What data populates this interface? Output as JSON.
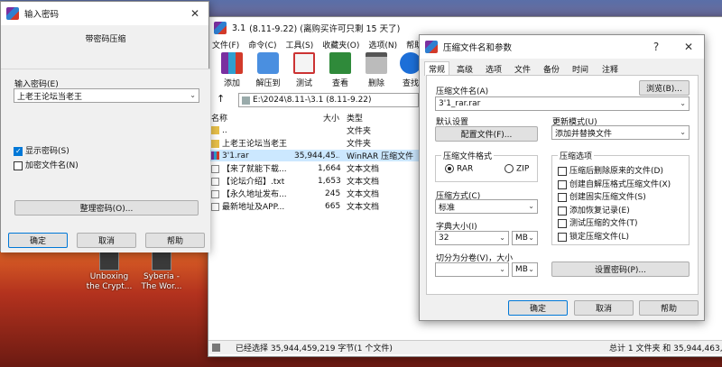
{
  "password_dialog": {
    "title": "输入密码",
    "heading": "带密码压缩",
    "password_label": "输入密码(E)",
    "password_value": "上老王论坛当老王",
    "show_password": "显示密码(S)",
    "encrypt_names": "加密文件名(N)",
    "organize_button": "整理密码(O)...",
    "ok": "确定",
    "cancel": "取消",
    "help": "帮助"
  },
  "winrar": {
    "title": "3.1",
    "subtitle": "(8.11-9.22) (离购买许可只剩 15 天了)",
    "menu": [
      "文件(F)",
      "命令(C)",
      "工具(S)",
      "收藏夹(O)",
      "选项(N)",
      "帮助"
    ],
    "toolbar": [
      "添加",
      "解压到",
      "测试",
      "查看",
      "删除",
      "查找"
    ],
    "up_label": "↑",
    "path": "E:\\2024\\8.11-\\3.1  (8.11-9.22)",
    "columns": {
      "name": "名称",
      "size": "大小",
      "type": "类型"
    },
    "files": [
      {
        "name": "..",
        "size": "",
        "type": "文件夹",
        "kind": "folder"
      },
      {
        "name": "上老王论坛当老王",
        "size": "",
        "type": "文件夹",
        "kind": "folder"
      },
      {
        "name": "3'1.rar",
        "size": "35,944,45...",
        "type": "WinRAR 压缩文件",
        "kind": "rar"
      },
      {
        "name": "【来了就能下载...",
        "size": "1,664",
        "type": "文本文档",
        "kind": "txt"
      },
      {
        "name": "【论坛介绍】.txt",
        "size": "1,653",
        "type": "文本文档",
        "kind": "txt"
      },
      {
        "name": "【永久地址发布...",
        "size": "245",
        "type": "文本文档",
        "kind": "txt"
      },
      {
        "name": "最新地址及APP...",
        "size": "665",
        "type": "文本文档",
        "kind": "txt"
      }
    ],
    "status_left": "已经选择 35,944,459,219 字节(1 个文件)",
    "status_right": "总计 1 文件夹 和 35,944,463,4"
  },
  "archive_dialog": {
    "title": "压缩文件名和参数",
    "help_glyph": "?",
    "tabs": [
      "常规",
      "高级",
      "选项",
      "文件",
      "备份",
      "时间",
      "注释"
    ],
    "archive_name_label": "压缩文件名(A)",
    "browse_button": "浏览(B)...",
    "archive_name_value": "3'1_rar.rar",
    "default_settings_label": "默认设置",
    "profiles_button": "配置文件(F)...",
    "update_mode_label": "更新模式(U)",
    "update_mode_value": "添加并替换文件",
    "format_group": "压缩文件格式",
    "format_rar": "RAR",
    "format_zip": "ZIP",
    "options_group": "压缩选项",
    "options": [
      "压缩后删除原来的文件(D)",
      "创建自解压格式压缩文件(X)",
      "创建固实压缩文件(S)",
      "添加恢复记录(E)",
      "测试压缩的文件(T)",
      "锁定压缩文件(L)"
    ],
    "method_label": "压缩方式(C)",
    "method_value": "标准",
    "dict_label": "字典大小(I)",
    "dict_value": "32",
    "dict_unit": "MB",
    "split_label": "切分为分卷(V)，大小",
    "split_value": "",
    "split_unit": "MB",
    "set_password_button": "设置密码(P)...",
    "ok": "确定",
    "cancel": "取消",
    "help": "帮助"
  },
  "desktop": {
    "icons": [
      {
        "line1": "Unboxing",
        "line2": "the Crypt..."
      },
      {
        "line1": "Syberia -",
        "line2": "The Wor..."
      }
    ]
  },
  "colors": {
    "accent": "#0078d7",
    "selected_row": "#cce8ff"
  }
}
